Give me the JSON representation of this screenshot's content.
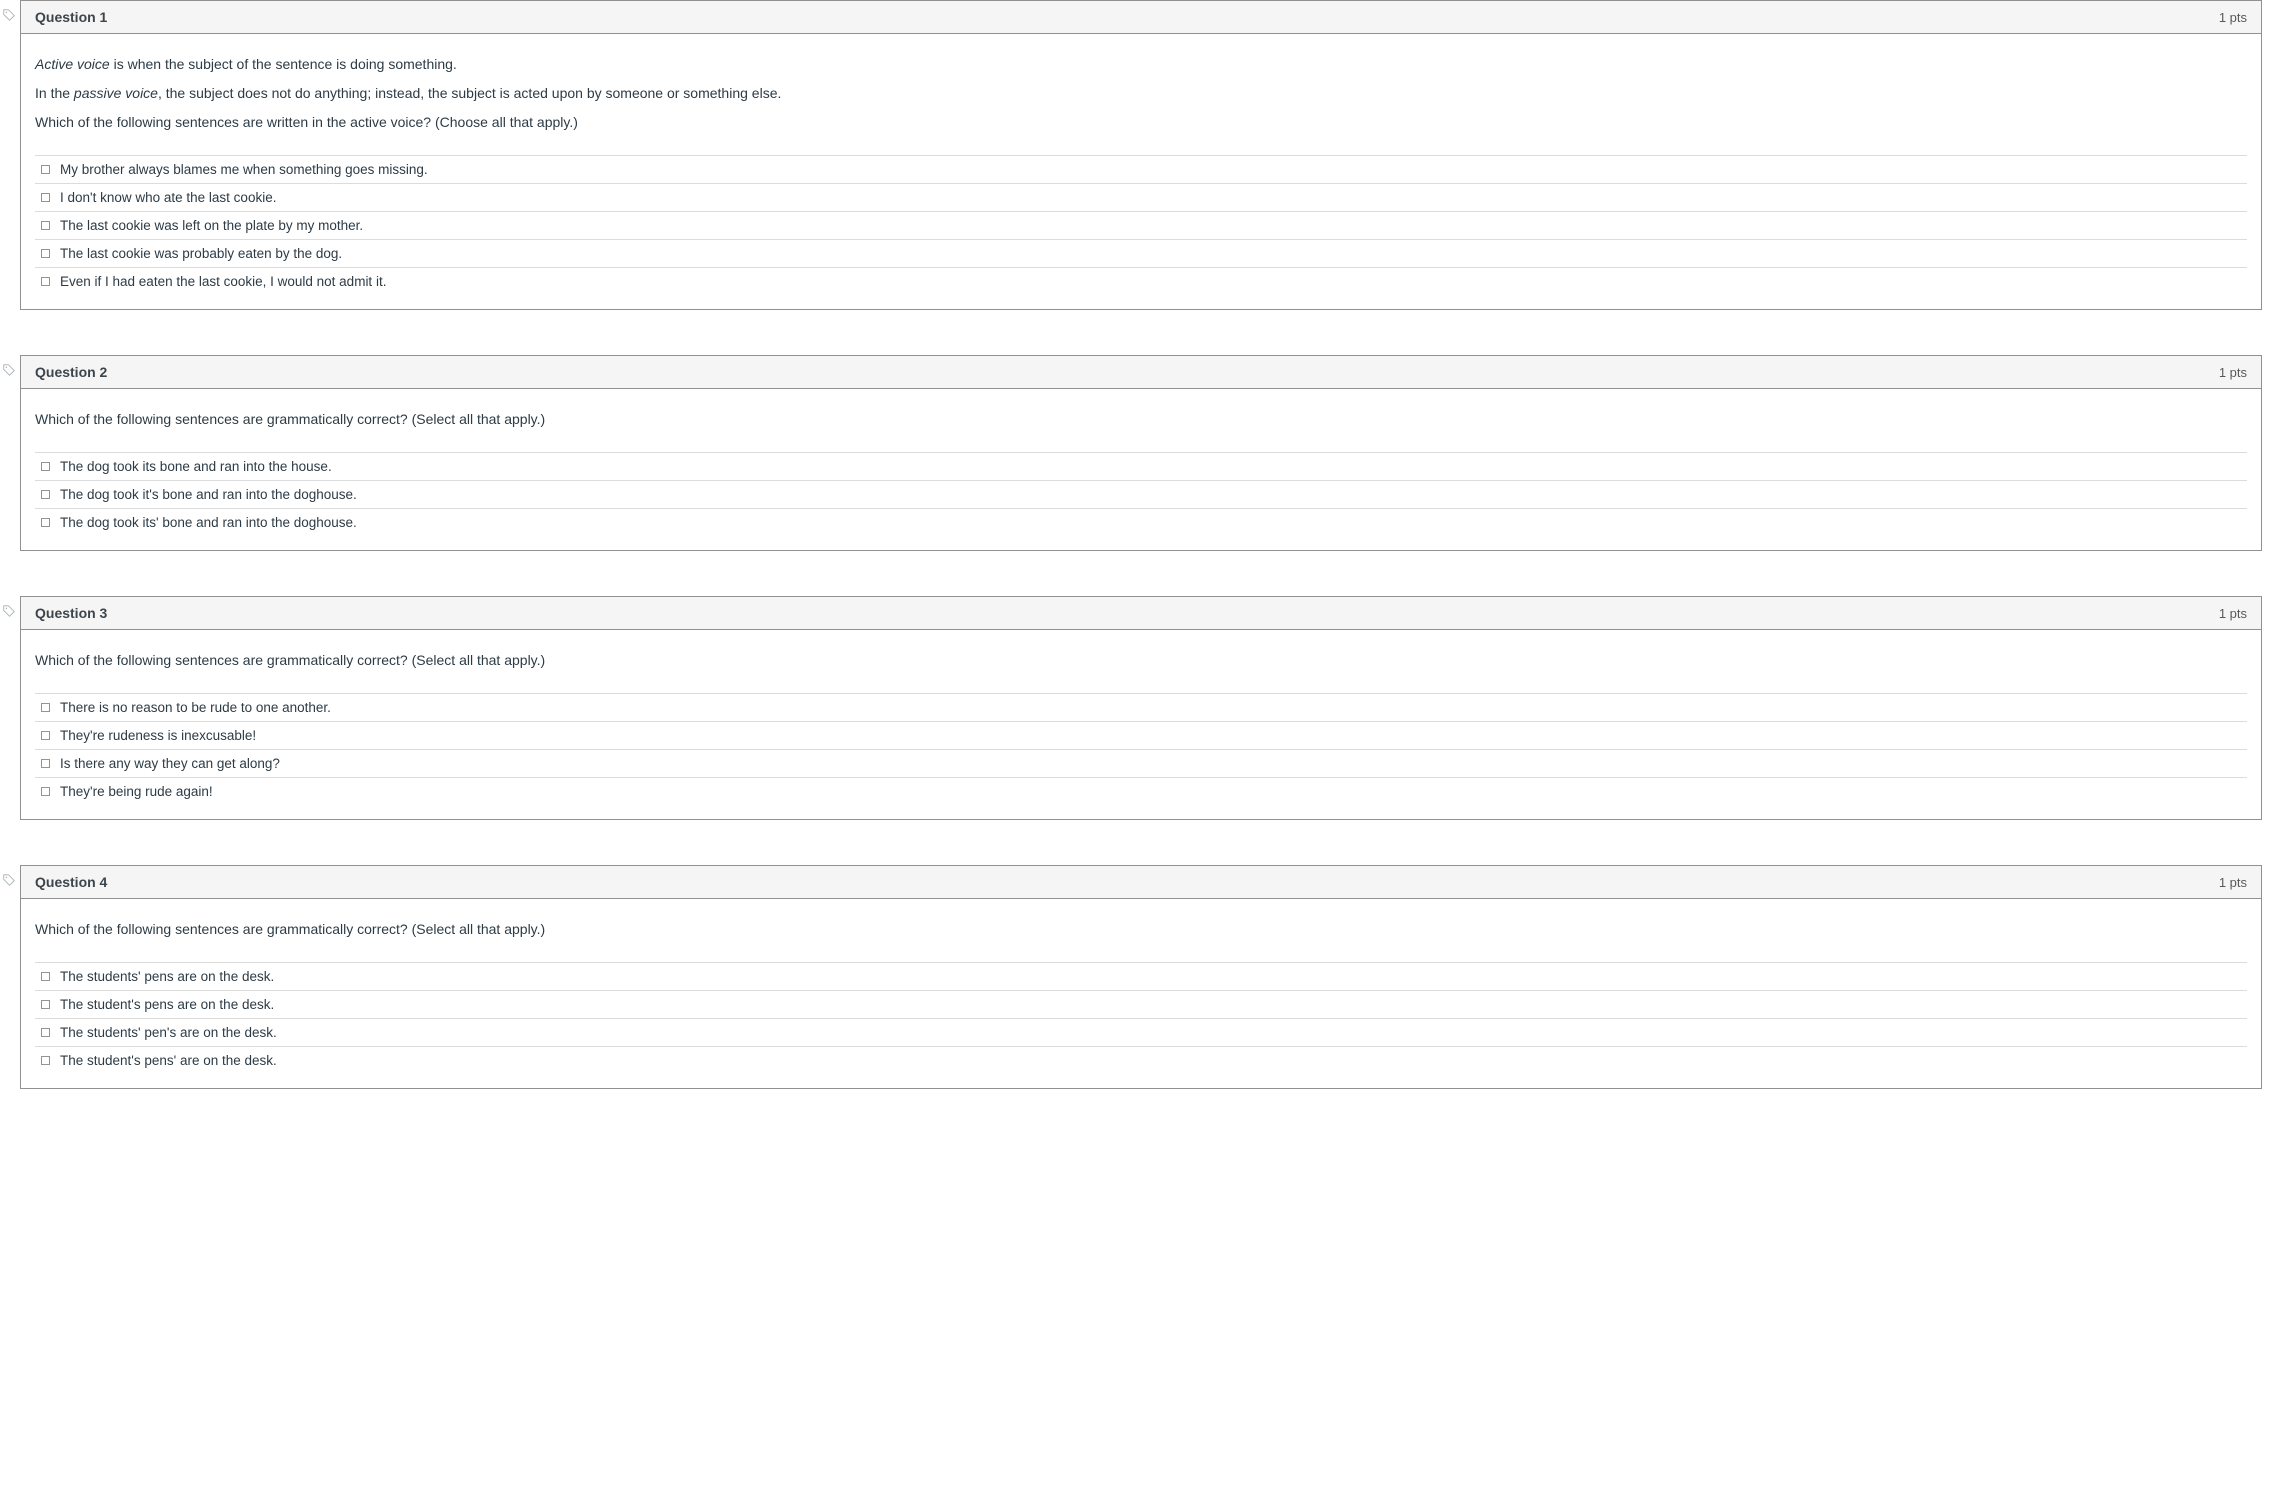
{
  "questions": [
    {
      "number": "Question 1",
      "points": "1 pts",
      "prompt_parts": [
        {
          "prefix_italic": "Active voice",
          "rest": " is when the subject of the sentence is doing something."
        },
        {
          "prefix": "In the ",
          "mid_italic": "passive voice",
          "rest": ", the subject does not do anything; instead, the subject is acted upon by someone or something else."
        },
        {
          "rest": "Which of the following sentences are written in the active voice? (Choose all that apply.)"
        }
      ],
      "answers": [
        "My brother always blames me when something goes missing.",
        "I don't know who ate the last cookie.",
        "The last cookie was left on the plate by my mother.",
        "The last cookie was probably eaten by the dog.",
        "Even if I had eaten the last cookie, I would not admit it."
      ]
    },
    {
      "number": "Question 2",
      "points": "1 pts",
      "prompt_parts": [
        {
          "rest": "Which of the following sentences are grammatically correct? (Select all that apply.)"
        }
      ],
      "answers": [
        "The dog took its bone and ran into the house.",
        "The dog took it's bone and ran into the doghouse.",
        "The dog took its' bone and ran into the doghouse."
      ]
    },
    {
      "number": "Question 3",
      "points": "1 pts",
      "prompt_parts": [
        {
          "rest": "Which of the following sentences are grammatically correct? (Select all that apply.)"
        }
      ],
      "answers": [
        "There is no reason to be rude to one another.",
        "They're rudeness is inexcusable!",
        "Is there any way they can get along?",
        "They're being rude again!"
      ]
    },
    {
      "number": "Question 4",
      "points": "1 pts",
      "prompt_parts": [
        {
          "rest": "Which of the following sentences are grammatically correct? (Select all that apply.)"
        }
      ],
      "answers": [
        "The students' pens are on the desk.",
        "The student's pens are on the desk.",
        "The students' pen's are on the desk.",
        "The student's pens' are on the desk."
      ]
    }
  ]
}
